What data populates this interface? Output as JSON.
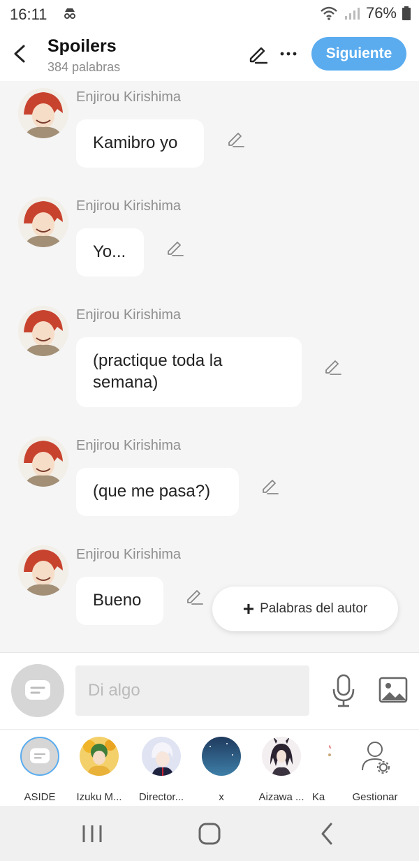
{
  "status_bar": {
    "time": "16:11",
    "battery": "76%"
  },
  "header": {
    "title": "Spoilers",
    "subtitle": "384 palabras",
    "next_label": "Siguiente",
    "accent": "#5aacef"
  },
  "messages": [
    {
      "sender": "Enjirou Kirishima",
      "text": "Kamibro yo"
    },
    {
      "sender": "Enjirou Kirishima",
      "text": "Yo..."
    },
    {
      "sender": "Enjirou Kirishima",
      "text": "(practique toda la semana)"
    },
    {
      "sender": "Enjirou Kirishima",
      "text": "(que me pasa?)"
    },
    {
      "sender": "Enjirou Kirishima",
      "text": "Bueno"
    }
  ],
  "author_words_label": "Palabras del autor",
  "input": {
    "placeholder": "Di algo"
  },
  "chat_bar": {
    "items": [
      {
        "label": "ASIDE"
      },
      {
        "label": "Izuku M..."
      },
      {
        "label": "Director..."
      },
      {
        "label": "x"
      },
      {
        "label": "Aizawa ..."
      },
      {
        "label": "Ka"
      },
      {
        "label": "Gestionar"
      }
    ]
  },
  "icons": {
    "back": "chevron-left-icon",
    "edit": "pencil-icon",
    "more": "more-horizontal-icon",
    "mic": "microphone-icon",
    "image": "image-icon",
    "manage": "manage-user-icon"
  }
}
